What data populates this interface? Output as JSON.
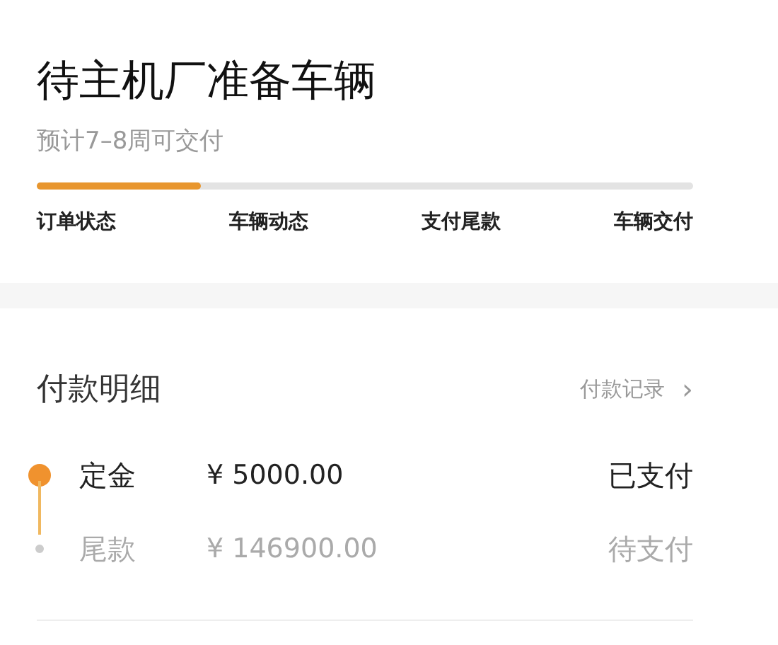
{
  "status": {
    "title": "待主机厂准备车辆",
    "subtitle": "预计7–8周可交付",
    "progress": {
      "level": 0.25
    },
    "steps": [
      "订单状态",
      "车辆动态",
      "支付尾款",
      "车辆交付"
    ]
  },
  "payment": {
    "title": "付款明细",
    "link": "付款记录",
    "link_icon": "›",
    "items": [
      {
        "name": "定金",
        "amount": "¥ 5000.00",
        "status": "已支付",
        "paid": true
      },
      {
        "name": "尾款",
        "amount": "¥ 146900.00",
        "status": "待支付",
        "paid": false
      }
    ]
  }
}
